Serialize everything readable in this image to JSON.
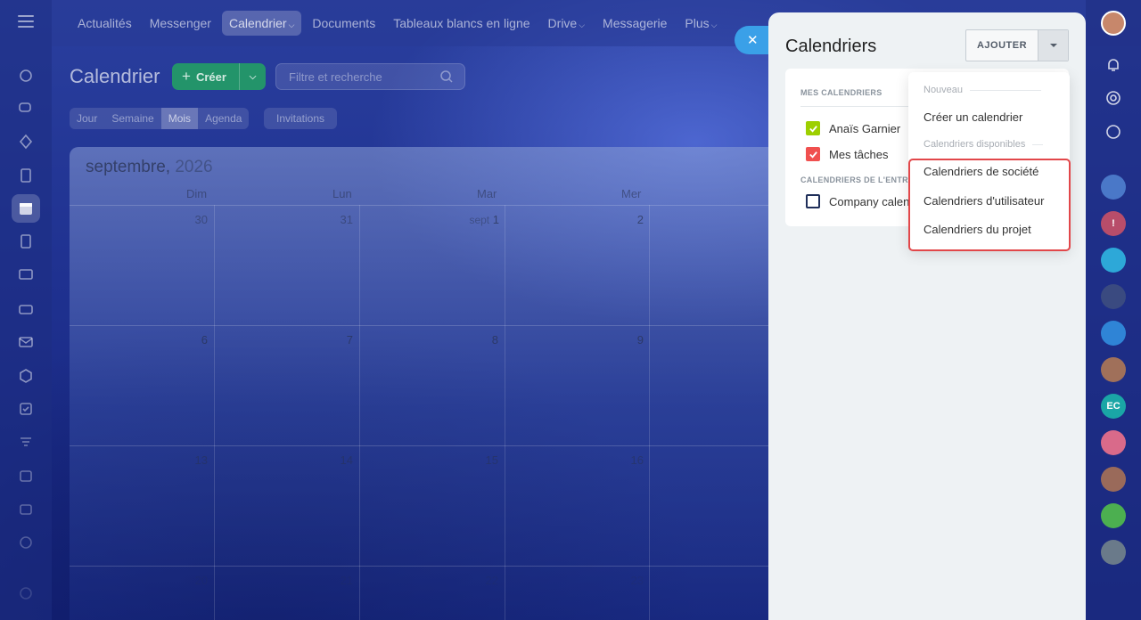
{
  "topnav": {
    "items": [
      {
        "label": "Actualités"
      },
      {
        "label": "Messenger"
      },
      {
        "label": "Calendrier",
        "chevron": "⌵"
      },
      {
        "label": "Documents"
      },
      {
        "label": "Tableaux blancs en ligne"
      },
      {
        "label": "Drive",
        "chevron": "⌵"
      },
      {
        "label": "Messagerie"
      },
      {
        "label": "Plus",
        "chevron": "⌵"
      }
    ]
  },
  "calendar": {
    "title": "Calendrier",
    "create_label": "Créer",
    "search_placeholder": "Filtre et recherche",
    "views": [
      "Jour",
      "Semaine",
      "Mois",
      "Agenda"
    ],
    "active_view": "Mois",
    "invitations_label": "Invitations",
    "month": "septembre,",
    "year": "2026",
    "weekdays": [
      "Dim",
      "Lun",
      "Mar",
      "Mer"
    ],
    "weeks": [
      [
        "30",
        "31",
        "1",
        "2"
      ],
      [
        "6",
        "7",
        "8",
        "9"
      ],
      [
        "13",
        "14",
        "15",
        "16"
      ],
      [
        "20",
        "21",
        "22",
        "23"
      ]
    ],
    "month_prefix": "sept"
  },
  "panel": {
    "title": "Calendriers",
    "add_label": "AJOUTER",
    "my_calendars_label": "MES CALENDRIERS",
    "my_calendars": [
      {
        "name": "Anaïs Garnier",
        "color": "#9dcf00"
      },
      {
        "name": "Mes tâches",
        "color": "#f0504f"
      }
    ],
    "company_label": "CALENDRIERS DE L'ENTREPRISE",
    "company_calendars": [
      {
        "name": "Company calendar"
      }
    ]
  },
  "menu": {
    "header_new": "Nouveau",
    "create_calendar": "Créer un calendrier",
    "header_available": "Calendriers disponibles",
    "company": "Calendriers de société",
    "user": "Calendriers d'utilisateur",
    "project": "Calendriers du projet"
  },
  "rightrail": {
    "initials": "EC"
  },
  "colors": {
    "accent_green": "#23946a",
    "close_blue": "#3aa0e8",
    "highlight_red": "#e2474a"
  }
}
